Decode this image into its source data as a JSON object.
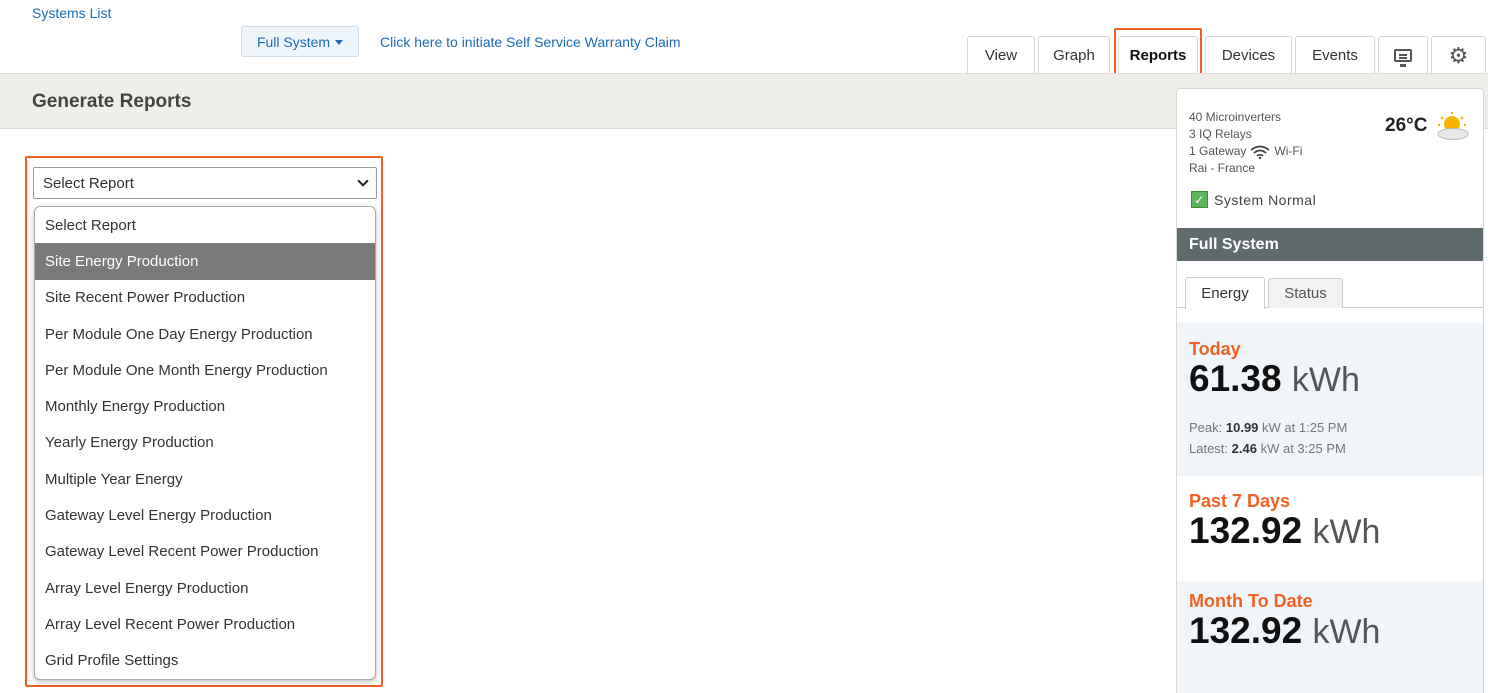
{
  "nav": {
    "systems_list": "Systems List",
    "system_selector": "Full System",
    "warranty_link": "Click here to initiate Self Service Warranty Claim"
  },
  "tabs": [
    {
      "label": "View"
    },
    {
      "label": "Graph"
    },
    {
      "label": "Reports",
      "active": true
    },
    {
      "label": "Devices"
    },
    {
      "label": "Events"
    }
  ],
  "icons": {
    "monitor": "monitor-icon",
    "settings": "gear-icon",
    "wifi": "wifi-icon",
    "weather": "partly-sunny-icon",
    "check": "check-icon"
  },
  "page": {
    "title": "Generate Reports"
  },
  "report_select": {
    "value": "Select Report",
    "options": [
      "Select Report",
      "Site Energy Production",
      "Site Recent Power Production",
      "Per Module One Day Energy Production",
      "Per Module One Month Energy Production",
      "Monthly Energy Production",
      "Yearly Energy Production",
      "Multiple Year Energy",
      "Gateway Level Energy Production",
      "Gateway Level Recent Power Production",
      "Array Level Energy Production",
      "Array Level Recent Power Production",
      "Grid Profile Settings"
    ],
    "highlighted_index": 1
  },
  "sidebar": {
    "microinverters": "40 Microinverters",
    "relays": "3 IQ Relays",
    "gateway": "1 Gateway",
    "gateway_conn": "Wi-Fi",
    "location": "Rai - France",
    "temperature": "26°C",
    "status": "System Normal",
    "section_title": "Full System",
    "energy_tab": "Energy",
    "status_tab": "Status",
    "today": {
      "label": "Today",
      "value": "61.38",
      "unit": "kWh",
      "peak_label": "Peak:",
      "peak_value": "10.99",
      "peak_suffix": "kW at 1:25 PM",
      "latest_label": "Latest:",
      "latest_value": "2.46",
      "latest_suffix": "kW at 3:25 PM"
    },
    "week": {
      "label": "Past 7 Days",
      "value": "132.92",
      "unit": "kWh"
    },
    "month": {
      "label": "Month To Date",
      "value": "132.92",
      "unit": "kWh"
    }
  },
  "colors": {
    "accent": "#f06223",
    "link": "#1f6bb5",
    "header_bar": "#5f6a6c"
  }
}
